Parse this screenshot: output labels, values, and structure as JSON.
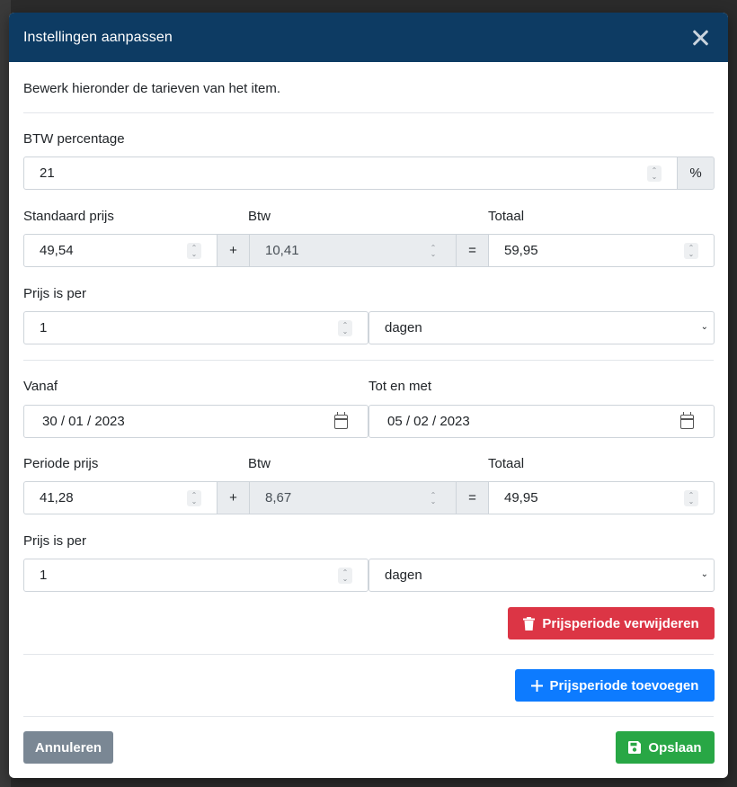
{
  "modal": {
    "title": "Instellingen aanpassen",
    "intro": "Bewerk hieronder de tarieven van het item."
  },
  "btw": {
    "label": "BTW percentage",
    "value": "21",
    "suffix": "%"
  },
  "standard": {
    "price_label": "Standaard prijs",
    "btw_label": "Btw",
    "total_label": "Totaal",
    "price": "49,54",
    "plus": "+",
    "btw": "10,41",
    "equals": "=",
    "total": "59,95",
    "per_label": "Prijs is per",
    "per_value": "1",
    "per_unit": "dagen"
  },
  "period": {
    "from_label": "Vanaf",
    "to_label": "Tot en met",
    "from_date": "30 / 01 / 2023",
    "to_date": "05 / 02 / 2023",
    "price_label": "Periode prijs",
    "btw_label": "Btw",
    "total_label": "Totaal",
    "price": "41,28",
    "plus": "+",
    "btw": "8,67",
    "equals": "=",
    "total": "49,95",
    "per_label": "Prijs is per",
    "per_value": "1",
    "per_unit": "dagen",
    "remove_button": "Prijsperiode verwijderen"
  },
  "actions": {
    "add_button": "Prijsperiode toevoegen",
    "cancel_button": "Annuleren",
    "save_button": "Opslaan"
  },
  "colors": {
    "header": "#0d3b63",
    "danger": "#dc3545",
    "primary": "#0d7bff",
    "secondary": "#7a8794",
    "success": "#28a745"
  },
  "icons": {
    "close": "close-icon",
    "trash": "trash-icon",
    "plus": "plus-icon",
    "save": "save-icon",
    "calendar": "calendar-icon"
  }
}
